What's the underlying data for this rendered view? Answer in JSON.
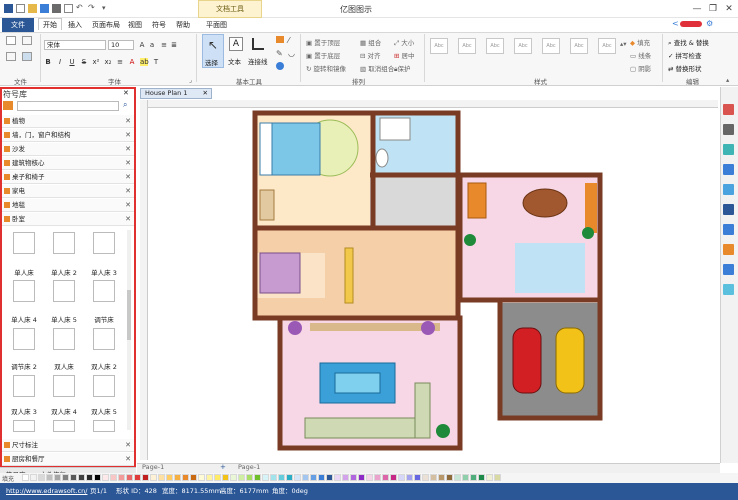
{
  "window": {
    "title": "亿图图示",
    "context_tab": "文档工具",
    "minimize": "—",
    "restore": "❐",
    "close": "✕",
    "user_icon": "user-icon"
  },
  "menu": {
    "file": "文件",
    "items": [
      "开始",
      "插入",
      "页面布局",
      "视图",
      "符号",
      "帮助",
      "平面图"
    ]
  },
  "ribbon": {
    "font_name": "宋体",
    "font_size": "10",
    "groups": {
      "file": "文件",
      "font": "字体",
      "basic_tools": "基本工具",
      "arrange": "排列",
      "style": "样式",
      "edit": "编辑"
    },
    "basic_tools": {
      "select": "选择",
      "text": "文本",
      "connector": "连接线"
    },
    "arrange": {
      "bring_front": "置于顶层",
      "send_back": "置于底层",
      "group": "组合",
      "align": "对齐",
      "size": "大小",
      "center": "居中",
      "rotate": "旋转和镜像",
      "ungroup": "取消组合",
      "protect": "保护"
    },
    "style_boxes": [
      "Abc",
      "Abc",
      "Abc",
      "Abc",
      "Abc",
      "Abc",
      "Abc"
    ],
    "fill": "填充",
    "line": "线条",
    "shadow": "阴影",
    "edit": {
      "find_replace": "查找 & 替换",
      "spell_check": "拼写检查",
      "format_painter": "替换形状"
    }
  },
  "library": {
    "title": "符号库",
    "search_placeholder": "",
    "categories_top": [
      "植物",
      "墙，门，窗户和结构",
      "沙发",
      "建筑物核心",
      "桌子和椅子",
      "家电",
      "地毯",
      "卧室"
    ],
    "categories_bottom": [
      "尺寸标注",
      "厨房和餐厅"
    ],
    "symbols": [
      [
        "单人床",
        "单人床 2",
        "单人床 3"
      ],
      [
        "单人床 4",
        "单人床 5",
        "调节床"
      ],
      [
        "调节床 2",
        "双人床",
        "双人床 2"
      ],
      [
        "双人床 3",
        "双人床 4",
        "双人床 5"
      ]
    ]
  },
  "bottom_tabs": [
    "符号库",
    "文件恢复"
  ],
  "document": {
    "tab": "House Plan 1",
    "page_tab": "Page-1",
    "page_label": "Page-1"
  },
  "status": {
    "url": "http://www.edrawsoft.cn/",
    "page": "页1/1",
    "shape_id": "形状 ID：428",
    "width": "宽度：8171.55mm",
    "height": "高度：6177mm",
    "angle": "角度：0deg",
    "fill_label": "填充"
  },
  "colors": {
    "accent": "#2b5797",
    "panel_border": "#e03030",
    "wall": "#7a3b24",
    "bedroom": "#fde9c8",
    "bathroom": "#bfe3f5",
    "corridor": "#d9d9d9",
    "living": "#f7d7e6",
    "garage": "#8c8c8c"
  }
}
